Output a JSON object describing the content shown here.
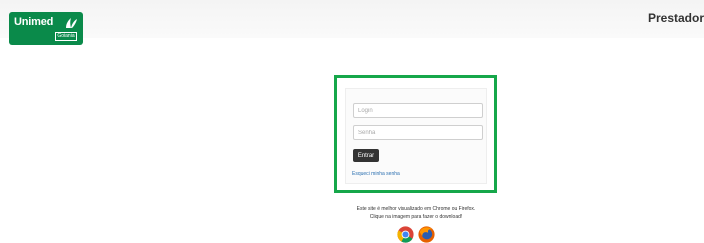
{
  "header": {
    "logo_text": "Unimed",
    "logo_sub": "Goiania",
    "brand_title": "Prestador"
  },
  "login": {
    "login_placeholder": "Login",
    "senha_placeholder": "Senha",
    "submit_label": "Entrar",
    "forgot_link": "Esqueci minha senha"
  },
  "footer": {
    "browser_note_line1": "Este site é melhor visualizado em Chrome ou Firefox.",
    "browser_note_line2": "Clique na imagem para fazer o download!",
    "browsers": [
      {
        "name": "chrome-icon"
      },
      {
        "name": "firefox-icon"
      }
    ]
  },
  "colors": {
    "brand_green": "#0a8a4a",
    "frame_green": "#16a74a",
    "button_dark": "#333333",
    "link_blue": "#2a6fb0"
  }
}
